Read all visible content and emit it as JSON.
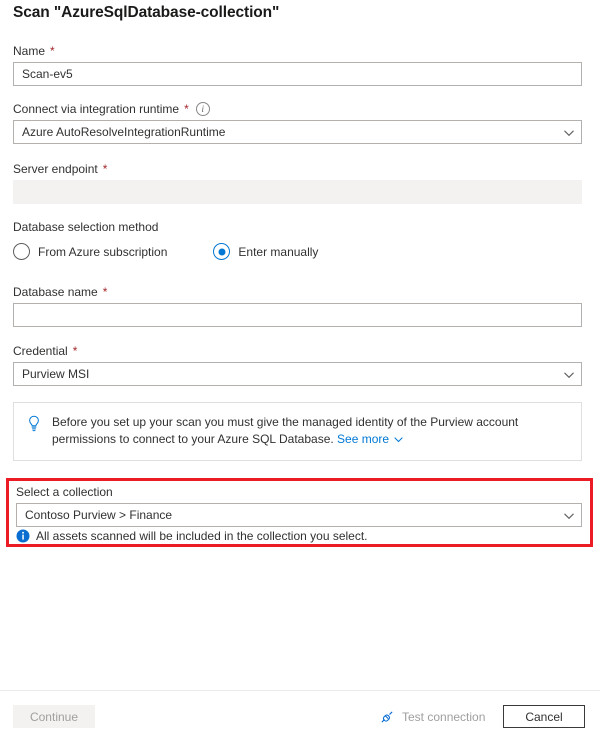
{
  "dialog": {
    "title": "Scan \"AzureSqlDatabase-collection\""
  },
  "form": {
    "name": {
      "label": "Name",
      "required_mark": "*",
      "value": "Scan-ev5",
      "placeholder": ""
    },
    "integration_runtime": {
      "label": "Connect via integration runtime",
      "required_mark": "*",
      "info_glyph": "i",
      "value": "Azure AutoResolveIntegrationRuntime"
    },
    "server_endpoint": {
      "label": "Server endpoint",
      "required_mark": "*",
      "value": "",
      "placeholder": "",
      "disabled": true
    },
    "database_selection_method": {
      "label": "Database selection method",
      "options": [
        {
          "label": "From Azure subscription",
          "selected": false
        },
        {
          "label": "Enter manually",
          "selected": true
        }
      ]
    },
    "database_name": {
      "label": "Database name",
      "required_mark": "*",
      "value": "",
      "placeholder": ""
    },
    "credential": {
      "label": "Credential",
      "required_mark": "*",
      "value": "Purview MSI"
    }
  },
  "tip_banner": {
    "icon": "lightbulb-icon",
    "text": "Before you set up your scan you must give the managed identity of the Purview account permissions to connect to your Azure SQL Database.",
    "link_label": "See more"
  },
  "collection_section": {
    "highlight_color": "#ec1c24",
    "label": "Select a collection",
    "value": "Contoso Purview > Finance",
    "note_icon": "info-circle-icon",
    "note": "All assets scanned will be included in the collection you select."
  },
  "footer": {
    "continue_label": "Continue",
    "continue_disabled": true,
    "test_connection_label": "Test connection",
    "test_connection_icon": "plug-icon",
    "cancel_label": "Cancel"
  },
  "colors": {
    "accent": "#0078d4",
    "required": "#a4262c",
    "highlight": "#ec1c24",
    "text": "#323130",
    "disabled_text": "#a19f9d"
  }
}
